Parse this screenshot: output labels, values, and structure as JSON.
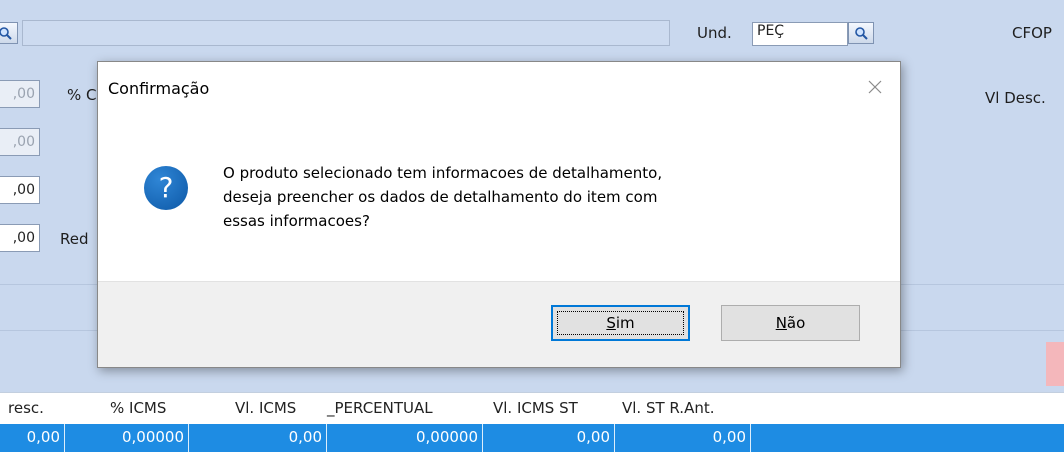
{
  "background": {
    "und_label": "Und.",
    "und_value": "PEÇ",
    "cfop_label": "CFOP",
    "vl_desc_label": "Vl Desc.",
    "pct_label": "% C",
    "red_label": "Red",
    "left_values": [
      ",00",
      ",00",
      ",00",
      ",00"
    ]
  },
  "grid": {
    "headers": [
      "resc.",
      "% ICMS",
      "Vl. ICMS",
      "_PERCENTUAL",
      "Vl. ICMS ST",
      "Vl. ST R.Ant."
    ],
    "row": [
      "0,00",
      "0,00000",
      "0,00",
      "0,00000",
      "0,00",
      "0,00"
    ],
    "selection_color": "#1e8ce3"
  },
  "dialog": {
    "title": "Confirmação",
    "close_icon": "close-icon",
    "question_icon": "?",
    "message_lines": [
      "O produto selecionado tem informacoes de detalhamento,",
      "deseja preencher os dados de detalhamento do item com",
      "essas informacoes?"
    ],
    "yes_label_accel": "S",
    "yes_label_rest": "im",
    "no_label_accel": "N",
    "no_label_rest": "ão",
    "accent": "#0078d7"
  }
}
